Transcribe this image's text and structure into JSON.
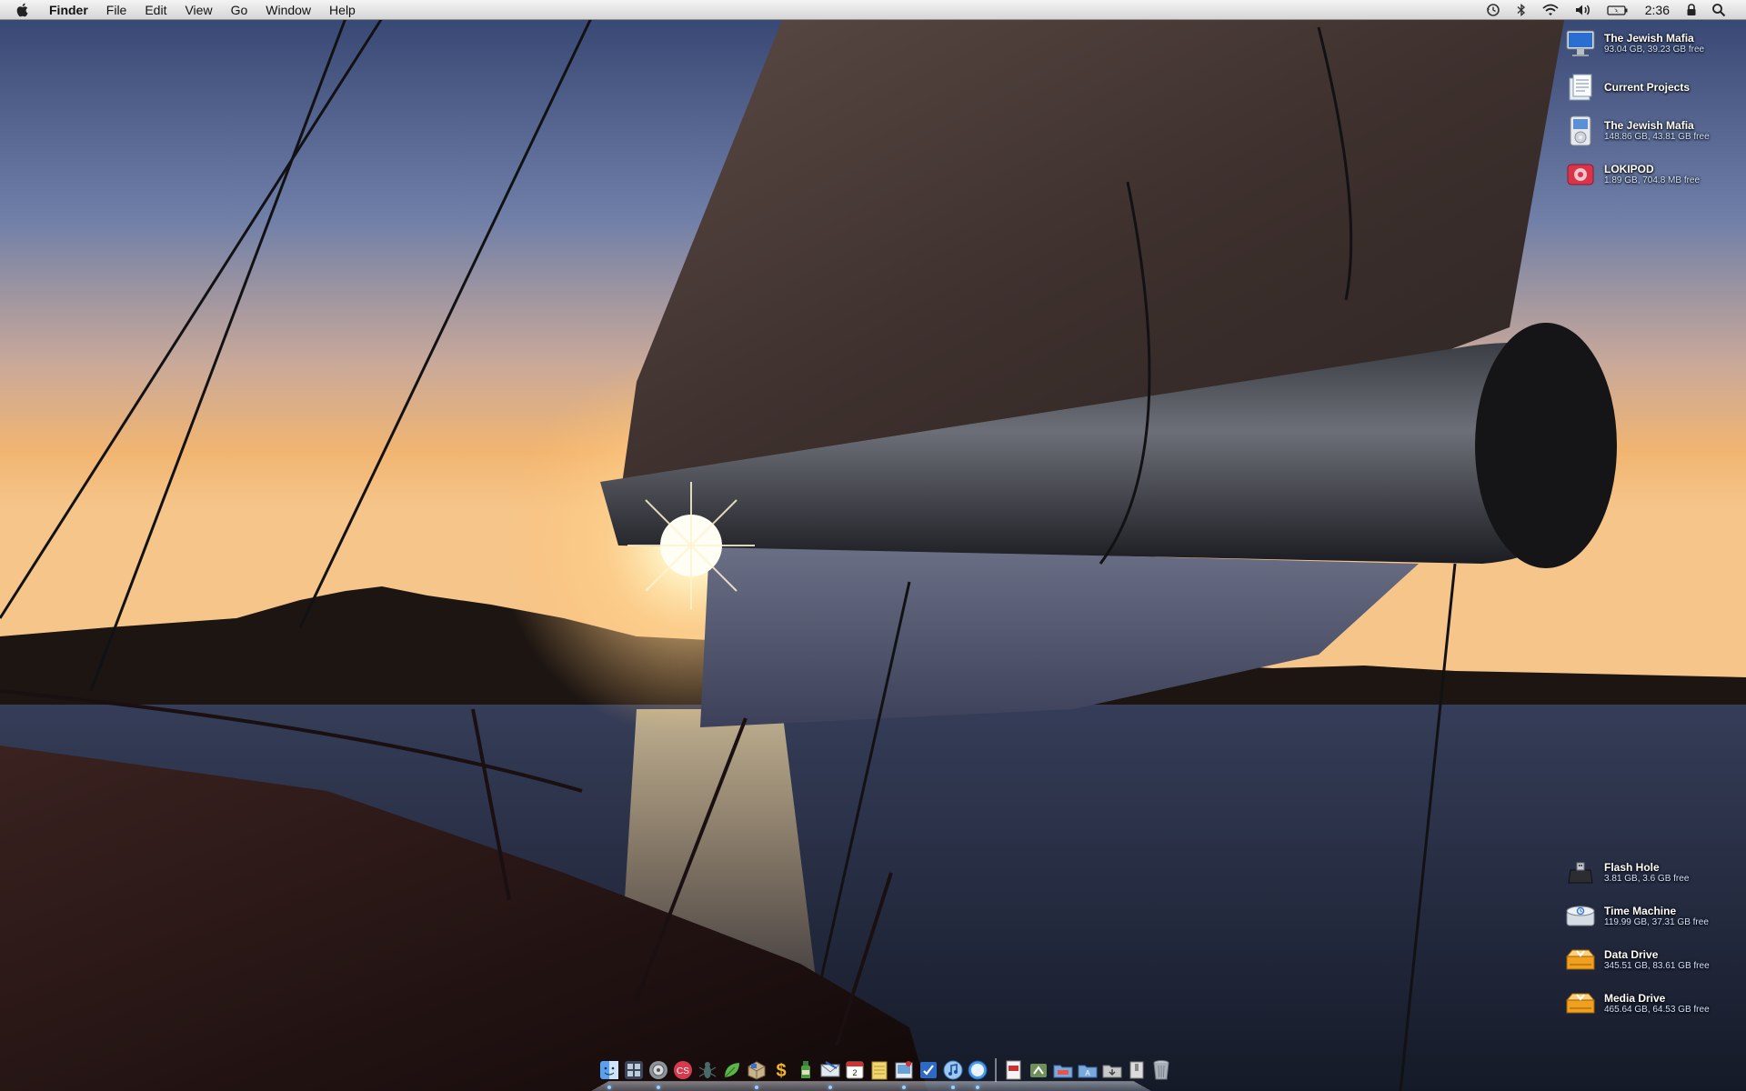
{
  "menubar": {
    "apple_icon": "apple-logo-icon",
    "app_name": "Finder",
    "menus": [
      "File",
      "Edit",
      "View",
      "Go",
      "Window",
      "Help"
    ],
    "clock": "2:36",
    "status_icons": [
      "time-machine-icon",
      "bluetooth-icon",
      "wifi-icon",
      "volume-icon",
      "battery-icon",
      "lock-icon",
      "spotlight-icon"
    ]
  },
  "desktop_icons": [
    {
      "name": "The Jewish Mafia",
      "info": "93.04 GB, 39.23 GB free",
      "icon": "computer-icon"
    },
    {
      "name": "Current Projects",
      "info": "",
      "icon": "document-icon"
    },
    {
      "name": "The Jewish Mafia",
      "info": "148.86 GB, 43.81 GB free",
      "icon": "ipod-icon"
    },
    {
      "name": "LOKIPOD",
      "info": "1.89 GB, 704.8 MB free",
      "icon": "ipod-shuffle-icon"
    },
    {
      "name": "Flash Hole",
      "info": "3.81 GB, 3.6 GB free",
      "icon": "usb-drive-icon"
    },
    {
      "name": "Time Machine",
      "info": "119.99 GB, 37.31 GB free",
      "icon": "time-machine-drive-icon"
    },
    {
      "name": "Data Drive",
      "info": "345.51 GB, 83.61 GB free",
      "icon": "external-drive-icon"
    },
    {
      "name": "Media Drive",
      "info": "465.64 GB, 64.53 GB free",
      "icon": "external-drive-icon"
    }
  ],
  "colors": {
    "sky_top": "#3b4a78",
    "sky_horizon": "#f2b06a",
    "sun": "#fff6d8",
    "water": "#1f2638",
    "sail": "#4a3a36",
    "drive_orange": "#f0a020"
  },
  "dock": {
    "apps": [
      {
        "icon": "finder-icon",
        "running": true
      },
      {
        "icon": "dashboard-icon",
        "running": false
      },
      {
        "icon": "system-preferences-icon",
        "running": true
      },
      {
        "icon": "creative-suite-icon",
        "running": false
      },
      {
        "icon": "ant-icon",
        "running": false
      },
      {
        "icon": "leaf-icon",
        "running": false
      },
      {
        "icon": "package-icon",
        "running": true
      },
      {
        "icon": "dollar-icon",
        "running": false
      },
      {
        "icon": "bottle-icon",
        "running": false
      },
      {
        "icon": "mail-icon",
        "running": true
      },
      {
        "icon": "calendar-icon",
        "running": false
      },
      {
        "icon": "notes-icon",
        "running": false
      },
      {
        "icon": "preview-icon",
        "running": true
      },
      {
        "icon": "script-icon",
        "running": false
      },
      {
        "icon": "itunes-icon",
        "running": true
      },
      {
        "icon": "safari-icon",
        "running": true
      }
    ],
    "docs": [
      {
        "icon": "pdf-icon"
      },
      {
        "icon": "utility-icon"
      },
      {
        "icon": "folder-icon"
      },
      {
        "icon": "app-folder-icon"
      },
      {
        "icon": "downloads-icon"
      },
      {
        "icon": "archive-icon"
      },
      {
        "icon": "trash-icon"
      }
    ]
  }
}
